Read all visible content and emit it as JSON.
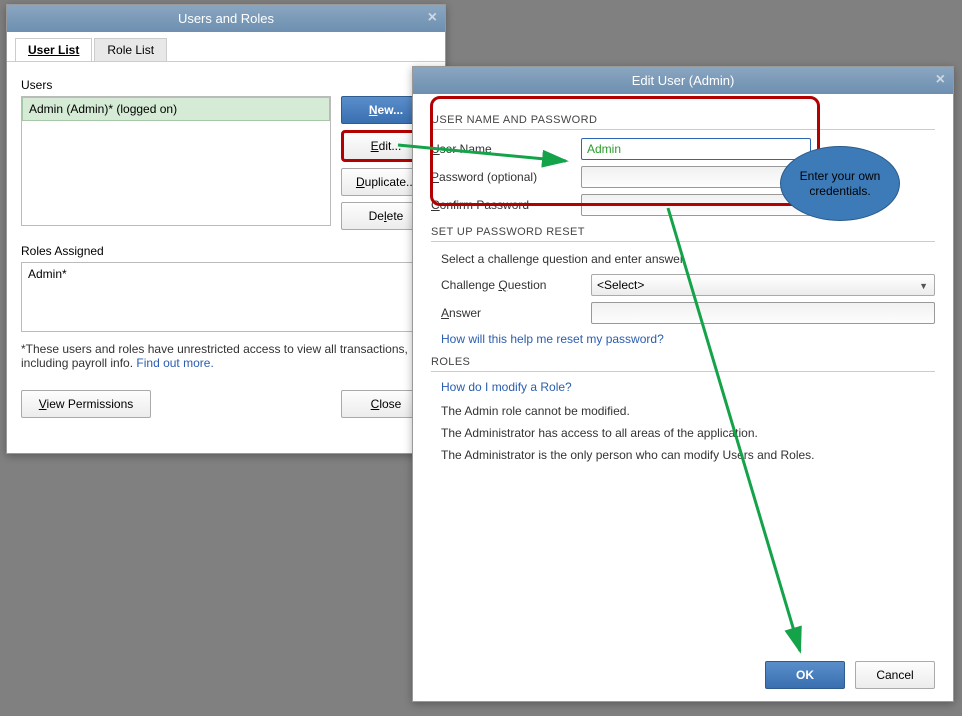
{
  "users_roles": {
    "title": "Users and Roles",
    "tabs": {
      "user_list": "User List",
      "role_list": "Role List"
    },
    "users_label": "Users",
    "user_item": "Admin (Admin)* (logged on)",
    "buttons": {
      "new": "New...",
      "edit": "Edit...",
      "duplicate": "Duplicate...",
      "delete": "Delete"
    },
    "roles_assigned_label": "Roles Assigned",
    "role_item": "Admin*",
    "note_prefix": "*These users and roles have unrestricted access to view all transactions, including payroll info. ",
    "note_link": "Find out more.",
    "view_permissions": "View Permissions",
    "close": "Close"
  },
  "edit_user": {
    "title": "Edit User (Admin)",
    "section1": "USER NAME AND PASSWORD",
    "labels": {
      "user_name": "User Name",
      "password": "Password (optional)",
      "confirm": "Confirm Password"
    },
    "user_name_value": "Admin",
    "section2": "SET UP PASSWORD RESET",
    "reset_instruction": "Select a challenge question and enter answer.",
    "challenge_label": "Challenge Question",
    "challenge_value": "<Select>",
    "answer_label": "Answer",
    "help_link": "How will this help me reset my password?",
    "section3": "ROLES",
    "roles_link": "How do I modify a Role?",
    "roles_desc1": "The Admin role cannot be modified.",
    "roles_desc2": "The Administrator has access to all areas of the application.",
    "roles_desc3": "The Administrator is the only person who can modify Users and Roles.",
    "ok": "OK",
    "cancel": "Cancel"
  },
  "annotation": {
    "callout": "Enter your own credentials."
  }
}
